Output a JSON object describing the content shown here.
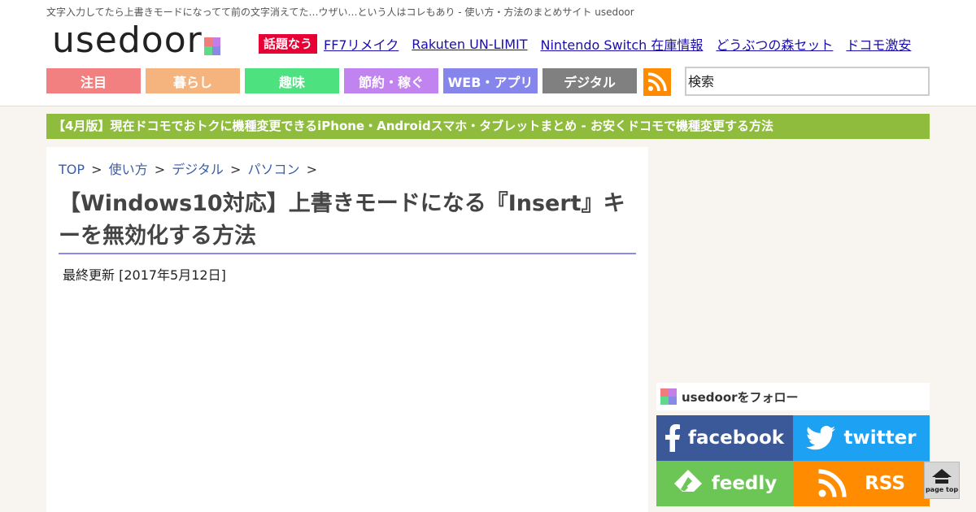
{
  "header": {
    "tagline": "文字入力してたら上書きモードになってて前の文字消えてた…ウザい…という人はコレもあり - 使い方・方法のまとめサイト usedoor",
    "logo_text": "usedoor",
    "logo_colors": [
      "#f07c7c",
      "#c47ee8",
      "#5fd98a",
      "#8a8ae6"
    ],
    "trend_badge": "話題なう",
    "trend_links": [
      "FF7リメイク",
      "Rakuten UN-LIMIT",
      "Nintendo Switch 在庫情報",
      "どうぶつの森セット",
      "ドコモ激安"
    ]
  },
  "nav": {
    "items": [
      {
        "label": "注目",
        "color": "#f28080"
      },
      {
        "label": "暮らし",
        "color": "#f5b47d"
      },
      {
        "label": "趣味",
        "color": "#4de17f"
      },
      {
        "label": "節約・稼ぐ",
        "color": "#c183f0"
      },
      {
        "label": "WEB・アプリ",
        "color": "#8585ec"
      },
      {
        "label": "デジタル",
        "color": "#808080"
      }
    ],
    "rss_icon": "rss-icon",
    "search_placeholder": "検索"
  },
  "promo": {
    "text": "【4月版】現在ドコモでおトクに機種変更できるiPhone・Androidスマホ・タブレットまとめ - お安くドコモで機種変更する方法"
  },
  "article": {
    "breadcrumb": [
      "TOP",
      "使い方",
      "デジタル",
      "パソコン"
    ],
    "breadcrumb_sep": ">",
    "title": "【Windows10対応】上書きモードになる『Insert』キーを無効化する方法",
    "updated": "最終更新 [2017年5月12日]"
  },
  "sidebar": {
    "follow_label": "usedoorをフォロー",
    "social": [
      {
        "label": "facebook",
        "icon": "facebook-icon",
        "color": "#3b5998"
      },
      {
        "label": "twitter",
        "icon": "twitter-icon",
        "color": "#1da1f2"
      },
      {
        "label": "feedly",
        "icon": "feedly-icon",
        "color": "#6cc655"
      },
      {
        "label": "RSS",
        "icon": "rss-icon",
        "color": "#ff8c00"
      }
    ]
  },
  "pagetop": {
    "label": "page top",
    "icon": "home-icon"
  }
}
